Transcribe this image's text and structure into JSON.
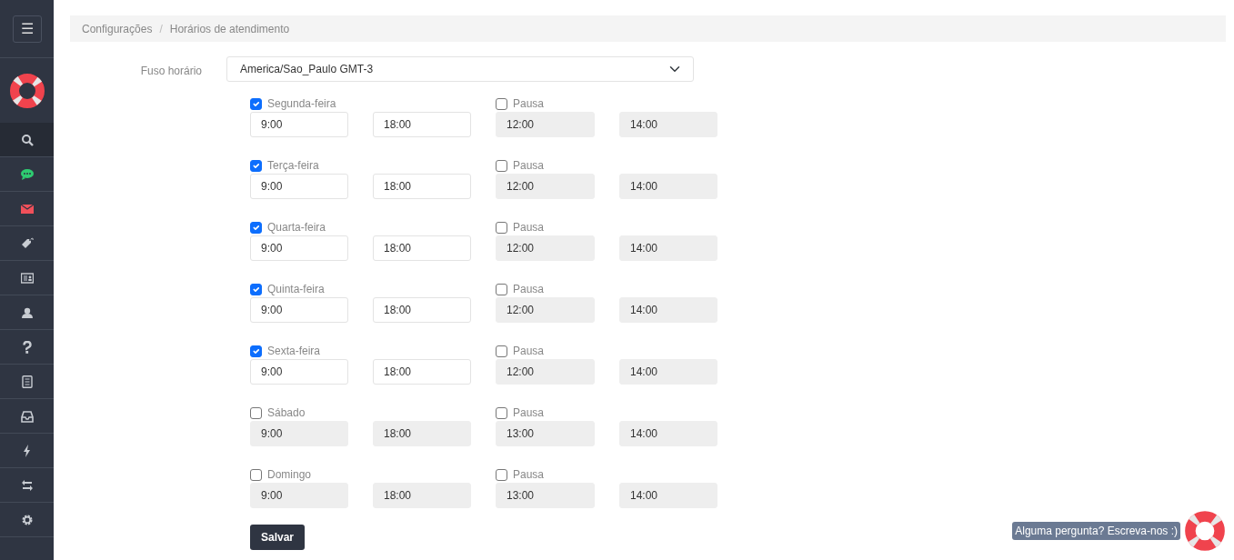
{
  "sidebar": {
    "menu_button": "☰",
    "items": [
      {
        "selected": true
      },
      {
        "selected": false
      },
      {
        "selected": false
      },
      {
        "selected": false
      },
      {
        "selected": false
      },
      {
        "selected": false
      },
      {
        "selected": false
      },
      {
        "selected": false
      },
      {
        "selected": false
      },
      {
        "selected": false
      },
      {
        "selected": false
      },
      {
        "selected": false
      }
    ]
  },
  "breadcrumb": [
    "Configurações",
    "Horários de atendimento"
  ],
  "breadcrumb_separator": "/",
  "timezone": {
    "label": "Fuso horário",
    "value": "America/Sao_Paulo GMT-3"
  },
  "days": [
    {
      "name": "Segunda-feira",
      "checked": true,
      "start": "9:00",
      "end": "18:00",
      "pause_label": "Pausa",
      "pause_checked": false,
      "pause_start": "12:00",
      "pause_end": "14:00"
    },
    {
      "name": "Terça-feira",
      "checked": true,
      "start": "9:00",
      "end": "18:00",
      "pause_label": "Pausa",
      "pause_checked": false,
      "pause_start": "12:00",
      "pause_end": "14:00"
    },
    {
      "name": "Quarta-feira",
      "checked": true,
      "start": "9:00",
      "end": "18:00",
      "pause_label": "Pausa",
      "pause_checked": false,
      "pause_start": "12:00",
      "pause_end": "14:00"
    },
    {
      "name": "Quinta-feira",
      "checked": true,
      "start": "9:00",
      "end": "18:00",
      "pause_label": "Pausa",
      "pause_checked": false,
      "pause_start": "12:00",
      "pause_end": "14:00"
    },
    {
      "name": "Sexta-feira",
      "checked": true,
      "start": "9:00",
      "end": "18:00",
      "pause_label": "Pausa",
      "pause_checked": false,
      "pause_start": "12:00",
      "pause_end": "14:00"
    },
    {
      "name": "Sábado",
      "checked": false,
      "start": "9:00",
      "end": "18:00",
      "pause_label": "Pausa",
      "pause_checked": false,
      "pause_start": "13:00",
      "pause_end": "14:00"
    },
    {
      "name": "Domingo",
      "checked": false,
      "start": "9:00",
      "end": "18:00",
      "pause_label": "Pausa",
      "pause_checked": false,
      "pause_start": "13:00",
      "pause_end": "14:00"
    }
  ],
  "save_button": "Salvar",
  "help_widget": {
    "text": "Alguma pergunta? Escreva-nos :)"
  }
}
